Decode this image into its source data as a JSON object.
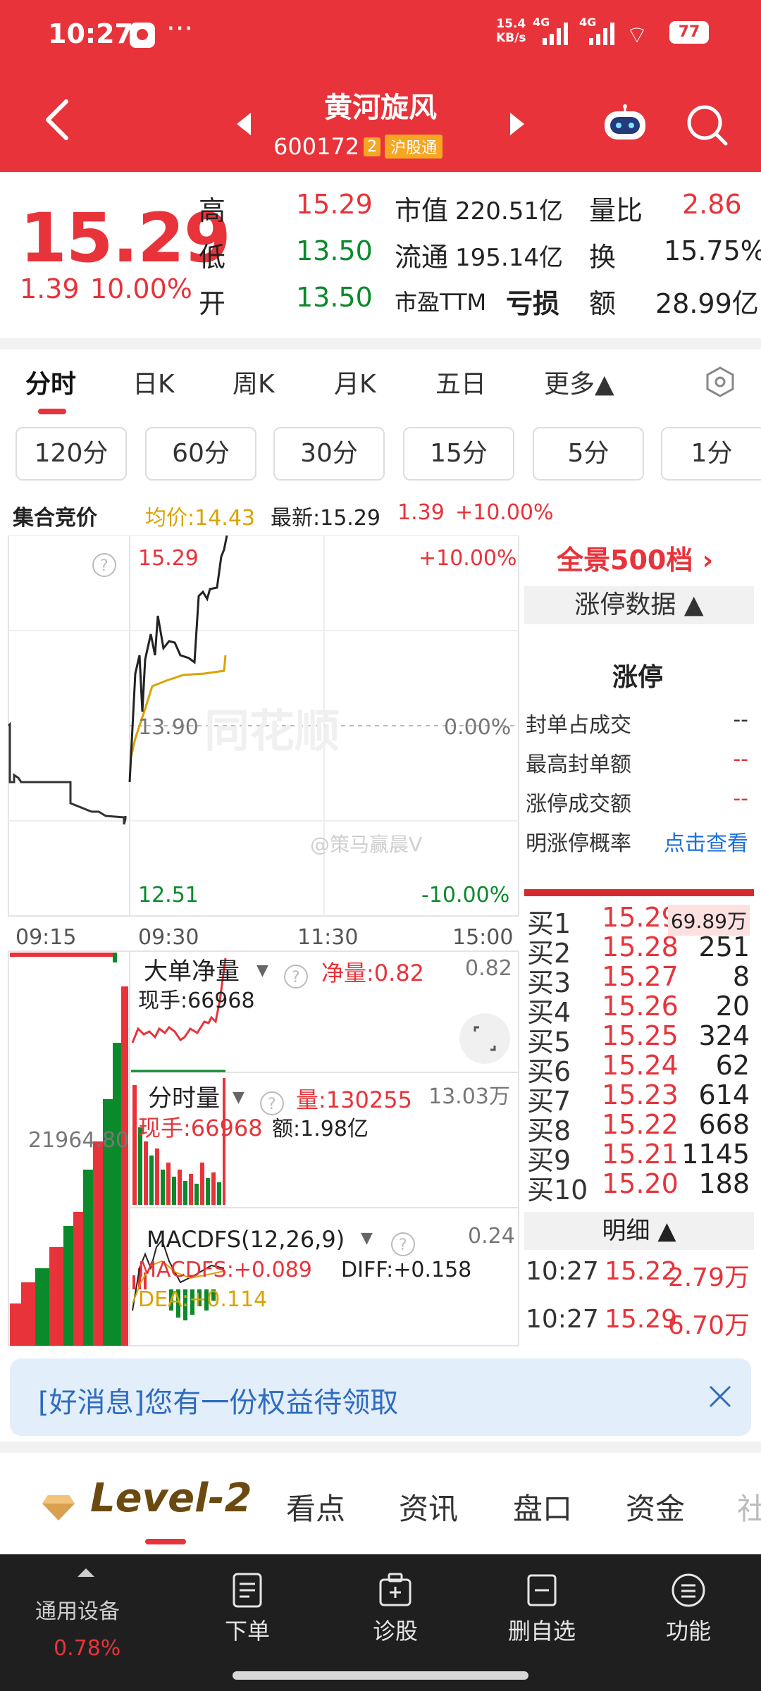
{
  "status": {
    "time": "10:27",
    "dots": "···",
    "net_speed": "15.4",
    "net_unit": "KB/s",
    "sig1": "4G",
    "sig2": "4G",
    "battery": "77"
  },
  "header": {
    "title": "黄河旋风",
    "code": "600172",
    "badge": "2",
    "tag": "沪股通"
  },
  "quote": {
    "price": "15.29",
    "change": "1.39",
    "change_pct": "10.00%",
    "high_label": "高",
    "high": "15.29",
    "low_label": "低",
    "low": "13.50",
    "open_label": "开",
    "open": "13.50",
    "mcap_label": "市值",
    "mcap": "220.51亿",
    "float_label": "流通",
    "float": "195.14亿",
    "pe_label": "市盈TTM",
    "pe": "亏损",
    "vr_label": "量比",
    "vr": "2.86",
    "turn_label": "换",
    "turn": "15.75%",
    "amt_label": "额",
    "amt": "28.99亿"
  },
  "tabs": [
    "分时",
    "日K",
    "周K",
    "月K",
    "五日",
    "更多▲"
  ],
  "periods": [
    "120分",
    "60分",
    "30分",
    "15分",
    "5分",
    "1分"
  ],
  "info": {
    "auction": "集合竞价",
    "avg": "均价:14.43",
    "latest": "最新:15.29",
    "chg": "1.39",
    "pct": "+10.00%"
  },
  "chart": {
    "price_high": "15.29",
    "price_mid": "13.90",
    "price_low": "12.51",
    "pct_high": "+10.00%",
    "pct_mid": "0.00%",
    "pct_low": "-10.00%",
    "times": [
      "09:15",
      "09:30",
      "11:30",
      "15:00"
    ],
    "watermark": "@策马赢晨V",
    "logo_watermark": "同花顺",
    "auction_value": "21964.80",
    "big_label": "大单净量",
    "big_net": "净量:0.82",
    "big_now": "现手:66968",
    "big_scale": "0.82",
    "vol_label": "分时量",
    "vol_value": "量:130255",
    "vol_now": "现手:66968",
    "vol_amt": "额:1.98亿",
    "vol_scale": "13.03万",
    "macd_label": "MACDFS(12,26,9)",
    "macd_value": "MACDFS:+0.089",
    "macd_diff": "DIFF:+0.158",
    "macd_dea": "DEA:+0.114",
    "macd_scale": "0.24",
    "colors": {
      "up": "#e8333a",
      "down": "#0a8a2a",
      "price": "#222222",
      "avg": "#d9a300"
    }
  },
  "panel": {
    "title": "全景500档",
    "sub": "涨停数据 ▲",
    "head": "涨停",
    "rows": [
      {
        "label": "封单占成交",
        "value": "--"
      },
      {
        "label": "最高封单额",
        "value": "--"
      },
      {
        "label": "涨停成交额",
        "value": "--"
      },
      {
        "label": "明涨停概率",
        "value": "点击查看"
      }
    ],
    "book": [
      {
        "level": "买1",
        "price": "15.29",
        "qty": "69.89万"
      },
      {
        "level": "买2",
        "price": "15.28",
        "qty": "251"
      },
      {
        "level": "买3",
        "price": "15.27",
        "qty": "8"
      },
      {
        "level": "买4",
        "price": "15.26",
        "qty": "20"
      },
      {
        "level": "买5",
        "price": "15.25",
        "qty": "324"
      },
      {
        "level": "买6",
        "price": "15.24",
        "qty": "62"
      },
      {
        "level": "买7",
        "price": "15.23",
        "qty": "614"
      },
      {
        "level": "买8",
        "price": "15.22",
        "qty": "668"
      },
      {
        "level": "买9",
        "price": "15.21",
        "qty": "1145"
      },
      {
        "level": "买10",
        "price": "15.20",
        "qty": "188"
      }
    ],
    "detail_head": "明细 ▲",
    "trades": [
      {
        "time": "10:27",
        "price": "15.22",
        "amount": "2.79万"
      },
      {
        "time": "10:27",
        "price": "15.29",
        "amount": "6.70万"
      }
    ]
  },
  "banner": {
    "text": "[好消息]您有一份权益待领取"
  },
  "bottom_tabs": {
    "level2": "Level-2",
    "items": [
      "看点",
      "资讯",
      "盘口",
      "资金",
      "社"
    ]
  },
  "bottombar": {
    "device_label": "通用设备",
    "device_value": "0.78%",
    "items": [
      "下单",
      "诊股",
      "删自选",
      "功能"
    ]
  }
}
